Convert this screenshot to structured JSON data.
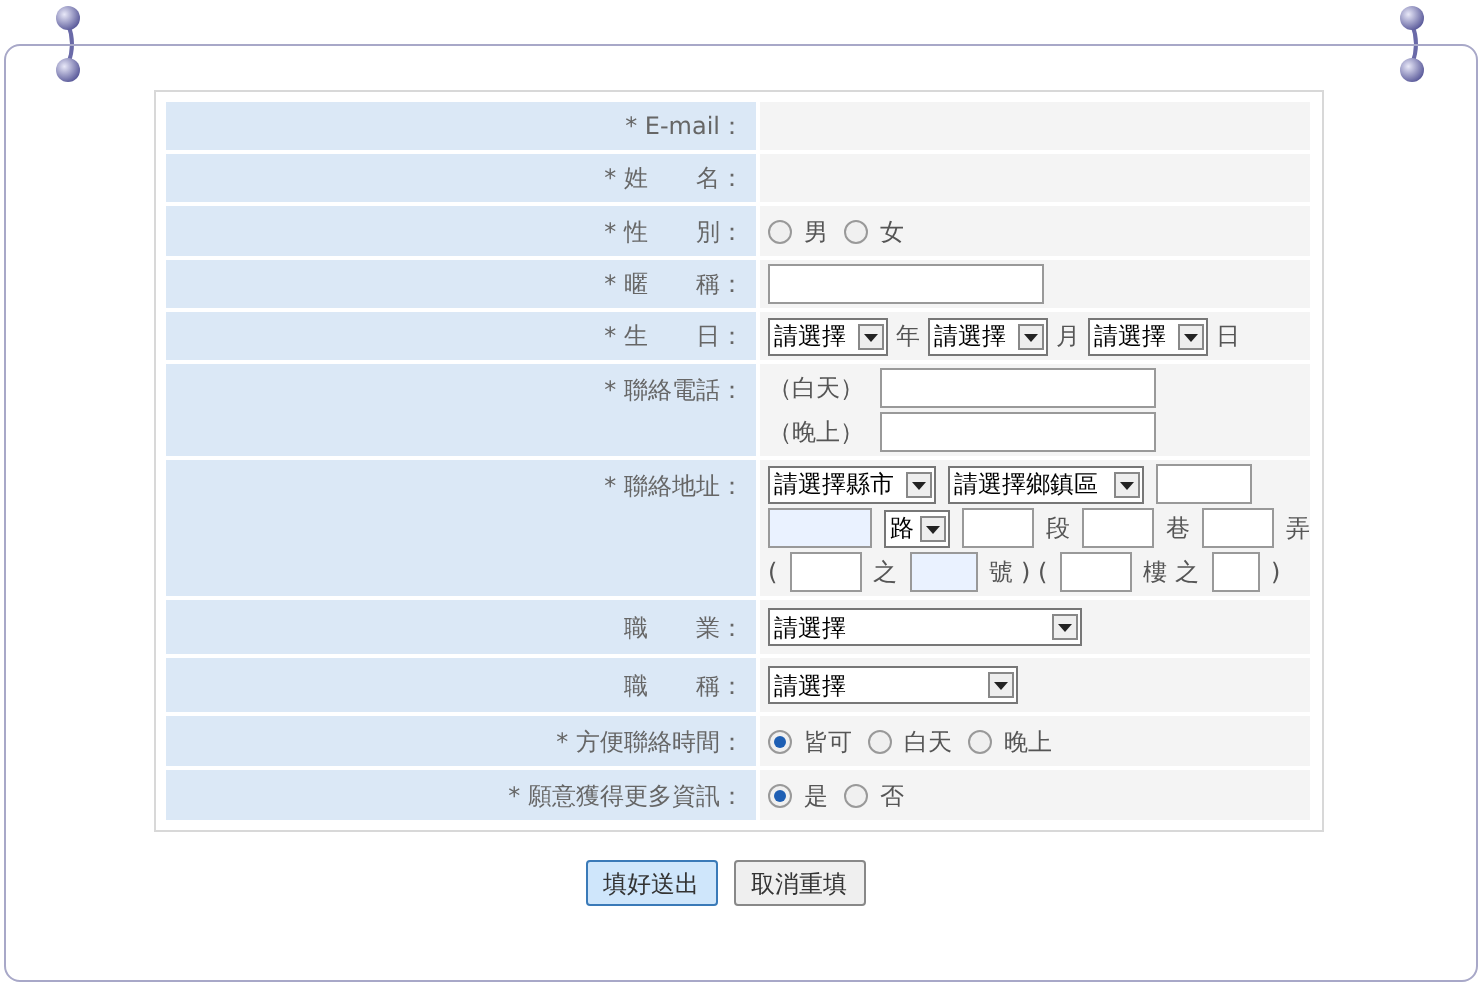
{
  "rows": [
    {
      "kind": "empty",
      "label": "* E-mail："
    },
    {
      "kind": "empty",
      "label": "* 姓　　名："
    },
    {
      "kind": "radio",
      "label": "* 性　　別：",
      "options": [
        {
          "label": "男",
          "selected": false
        },
        {
          "label": "女",
          "selected": false
        }
      ]
    },
    {
      "kind": "text",
      "label": "* 暱　　稱："
    },
    {
      "kind": "birthday",
      "label": "* 生　　日：",
      "selects": [
        {
          "value": "請選擇",
          "suffix": "年"
        },
        {
          "value": "請選擇",
          "suffix": "月"
        },
        {
          "value": "請選擇",
          "suffix": "日"
        }
      ]
    },
    {
      "kind": "phone",
      "label": "* 聯絡電話：",
      "lines": [
        {
          "label": "（白天）"
        },
        {
          "label": "（晚上）"
        }
      ]
    },
    {
      "kind": "address",
      "label": "* 聯絡地址：",
      "lines": [
        [
          {
            "kind": "select",
            "value": "請選擇縣市"
          },
          {
            "kind": "select",
            "value": "請選擇鄉鎮區"
          },
          {
            "kind": "input",
            "highlighted": false
          }
        ],
        [
          {
            "kind": "input",
            "highlighted": true
          },
          {
            "kind": "select",
            "value": "路"
          },
          {
            "kind": "input",
            "highlighted": false
          },
          {
            "kind": "text",
            "text": "段"
          },
          {
            "kind": "input",
            "highlighted": false
          },
          {
            "kind": "text",
            "text": "巷"
          },
          {
            "kind": "input",
            "highlighted": false
          },
          {
            "kind": "text",
            "text": "弄"
          }
        ],
        [
          {
            "kind": "text",
            "text": "("
          },
          {
            "kind": "input",
            "highlighted": false
          },
          {
            "kind": "text",
            "text": "之"
          },
          {
            "kind": "input",
            "highlighted": true
          },
          {
            "kind": "text",
            "text": "號 ) ("
          },
          {
            "kind": "input",
            "highlighted": false
          },
          {
            "kind": "text",
            "text": "樓 之"
          },
          {
            "kind": "input",
            "highlighted": false
          },
          {
            "kind": "text",
            "text": ")"
          }
        ]
      ]
    },
    {
      "kind": "select",
      "label": "職　　業：",
      "value": "請選擇"
    },
    {
      "kind": "select",
      "label": "職　　稱：",
      "value": "請選擇"
    },
    {
      "kind": "radio",
      "label": "* 方便聯絡時間：",
      "options": [
        {
          "label": "皆可",
          "selected": true
        },
        {
          "label": "白天",
          "selected": false
        },
        {
          "label": "晚上",
          "selected": false
        }
      ]
    },
    {
      "kind": "radio",
      "label": "* 願意獲得更多資訊：",
      "options": [
        {
          "label": "是",
          "selected": true
        },
        {
          "label": "否",
          "selected": false
        }
      ]
    }
  ],
  "buttons": [
    {
      "label": "填好送出",
      "kind": "primary"
    },
    {
      "label": "取消重填",
      "kind": "secondary"
    }
  ]
}
